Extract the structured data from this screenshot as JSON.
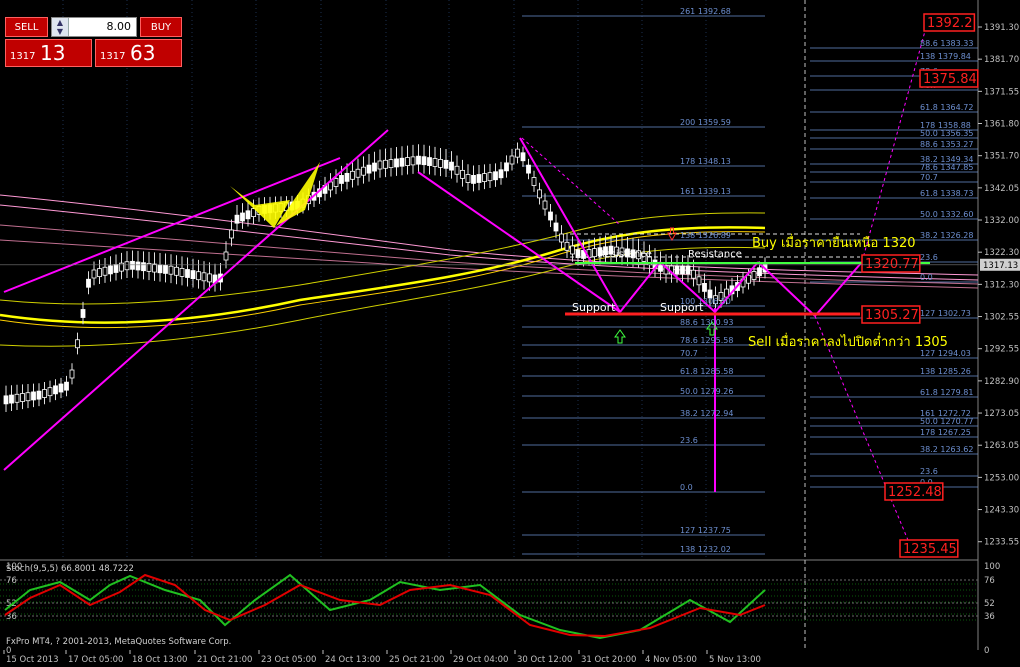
{
  "trade_panel": {
    "sell_label": "SELL",
    "buy_label": "BUY",
    "lot_value": "8.00",
    "bid_prefix": "1317",
    "bid_big": "13",
    "ask_prefix": "1317",
    "ask_big": "63"
  },
  "price_axis": [
    "1391.30",
    "1381.70",
    "1371.55",
    "1361.80",
    "1351.70",
    "1342.05",
    "1332.00",
    "1322.30",
    "1312.30",
    "1302.55",
    "1292.55",
    "1282.90",
    "1273.05",
    "1263.05",
    "1253.00",
    "1243.30",
    "1233.55"
  ],
  "current_price": "1317.13",
  "time_axis": [
    "15 Oct 2013",
    "17 Oct 05:00",
    "18 Oct 13:00",
    "21 Oct 21:00",
    "23 Oct 05:00",
    "24 Oct 13:00",
    "25 Oct 21:00",
    "29 Oct 04:00",
    "30 Oct 12:00",
    "31 Oct 20:00",
    "4 Nov 05:00",
    "5 Nov 13:00"
  ],
  "fib_left": [
    {
      "p": "261",
      "v": "1392.68"
    },
    {
      "p": "200",
      "v": "1359.59"
    },
    {
      "p": "178",
      "v": "1348.13"
    },
    {
      "p": "161",
      "v": "1339.13"
    },
    {
      "p": "138",
      "v": "1326.89"
    },
    {
      "p": "100",
      "v": "1306.50"
    },
    {
      "p": "88.6",
      "v": "1300.93"
    },
    {
      "p": "78.6",
      "v": "1295.58"
    },
    {
      "p": "70.7",
      "v": ""
    },
    {
      "p": "61.8",
      "v": "1285.58"
    },
    {
      "p": "50.0",
      "v": "1279.26"
    },
    {
      "p": "38.2",
      "v": "1272.94"
    },
    {
      "p": "23.6",
      "v": ""
    },
    {
      "p": "0.0",
      "v": ""
    },
    {
      "p": "127",
      "v": "1237.75"
    },
    {
      "p": "138",
      "v": "1232.02"
    }
  ],
  "fib_right": [
    {
      "p": "88.6",
      "v": "1383.33"
    },
    {
      "p": "138",
      "v": "1379.84"
    },
    {
      "p": "78.6",
      "v": ""
    },
    {
      "p": "70.7",
      "v": ""
    },
    {
      "p": "61.8",
      "v": "1364.72"
    },
    {
      "p": "178",
      "v": "1358.88"
    },
    {
      "p": "50.0",
      "v": "1356.35"
    },
    {
      "p": "88.6",
      "v": "1353.27"
    },
    {
      "p": "38.2",
      "v": "1349.34"
    },
    {
      "p": "78.6",
      "v": "1347.85"
    },
    {
      "p": "70.7",
      "v": ""
    },
    {
      "p": "61.8",
      "v": "1338.73"
    },
    {
      "p": "50.0",
      "v": "1332.60"
    },
    {
      "p": "38.2",
      "v": "1326.28"
    },
    {
      "p": "23.6",
      "v": ""
    },
    {
      "p": "0.0",
      "v": ""
    },
    {
      "p": "127",
      "v": "1302.73"
    },
    {
      "p": "127",
      "v": "1294.03"
    },
    {
      "p": "138",
      "v": "1285.26"
    },
    {
      "p": "61.8",
      "v": "1279.81"
    },
    {
      "p": "161",
      "v": "1272.72"
    },
    {
      "p": "50.0",
      "v": "1270.77"
    },
    {
      "p": "178",
      "v": "1267.25"
    },
    {
      "p": "38.2",
      "v": "1263.62"
    },
    {
      "p": "23.6",
      "v": ""
    },
    {
      "p": "0.0",
      "v": ""
    }
  ],
  "price_labels": {
    "p1": "1392.2",
    "p2": "1375.84",
    "p3": "1320.77",
    "p4": "1305.27",
    "p5": "1252.48",
    "p6": "1235.45"
  },
  "annotations": {
    "buy_text": "Buy เมื่อราคายืนเหนือ 1320",
    "sell_text": "Sell เมื่อราคาลงไปปิดต่ำกว่า 1305",
    "support1": "Support",
    "support2": "Support",
    "resistance1": "Resistance",
    "resistance2": "Resistance"
  },
  "stoch": {
    "header": "Stoch(9,5,5) 66.8001 48.7222",
    "levels": [
      "100",
      "76",
      "52",
      "36",
      "0"
    ],
    "copyright": "FxPro MT4, ? 2001-2013, MetaQuotes Software Corp."
  },
  "colors": {
    "magenta": "#ff00ff",
    "yellow": "#ffff00",
    "red": "#e00000",
    "green": "#00c000",
    "fib": "#6d8fd0",
    "grid": "#1d3050"
  }
}
